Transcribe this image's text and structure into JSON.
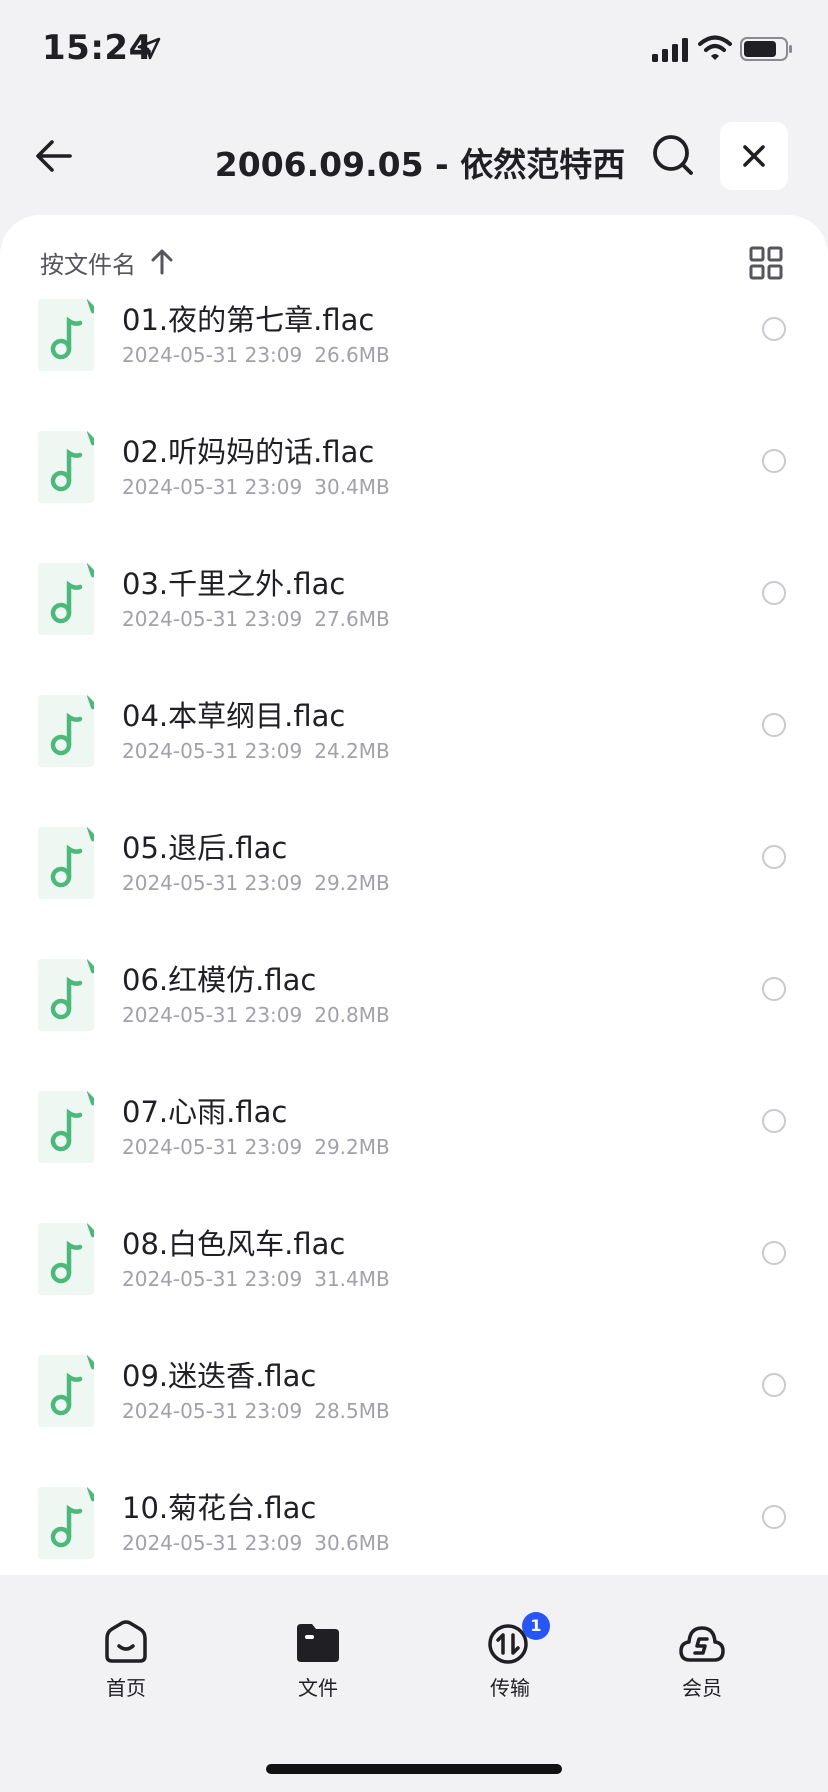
{
  "status": {
    "time": "15:24"
  },
  "header": {
    "title": "2006.09.05 - 依然范特西"
  },
  "sort": {
    "label": "按文件名"
  },
  "files": [
    {
      "name": "01.夜的第七章.flac",
      "date": "2024-05-31 23:09",
      "size": "26.6MB"
    },
    {
      "name": "02.听妈妈的话.flac",
      "date": "2024-05-31 23:09",
      "size": "30.4MB"
    },
    {
      "name": "03.千里之外.flac",
      "date": "2024-05-31 23:09",
      "size": "27.6MB"
    },
    {
      "name": "04.本草纲目.flac",
      "date": "2024-05-31 23:09",
      "size": "24.2MB"
    },
    {
      "name": "05.退后.flac",
      "date": "2024-05-31 23:09",
      "size": "29.2MB"
    },
    {
      "name": "06.红模仿.flac",
      "date": "2024-05-31 23:09",
      "size": "20.8MB"
    },
    {
      "name": "07.心雨.flac",
      "date": "2024-05-31 23:09",
      "size": "29.2MB"
    },
    {
      "name": "08.白色风车.flac",
      "date": "2024-05-31 23:09",
      "size": "31.4MB"
    },
    {
      "name": "09.迷迭香.flac",
      "date": "2024-05-31 23:09",
      "size": "28.5MB"
    },
    {
      "name": "10.菊花台.flac",
      "date": "2024-05-31 23:09",
      "size": "30.6MB"
    }
  ],
  "tabs": [
    {
      "label": "首页",
      "icon": "home-icon"
    },
    {
      "label": "文件",
      "icon": "folder-icon"
    },
    {
      "label": "传输",
      "icon": "transfer-icon",
      "badge": "1"
    },
    {
      "label": "会员",
      "icon": "vip-cloud-icon"
    }
  ],
  "colors": {
    "accent_green": "#4cb87a",
    "badge_blue": "#2756f5"
  }
}
